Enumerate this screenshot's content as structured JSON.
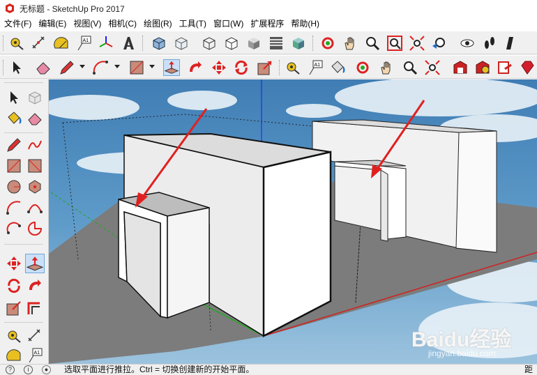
{
  "window": {
    "title": "无标题 - SketchUp Pro 2017"
  },
  "menu": [
    "文件(F)",
    "编辑(E)",
    "视图(V)",
    "相机(C)",
    "绘图(R)",
    "工具(T)",
    "窗口(W)",
    "扩展程序",
    "帮助(H)"
  ],
  "status": {
    "hint": "选取平面进行推拉。Ctrl = 切换创建新的开始平面。",
    "right_label": "距"
  },
  "watermark": {
    "brand": "Baidu经验",
    "url": "jingyan.baidu.com"
  },
  "tools": {
    "active": "push-pull",
    "text_label_icon": "A1"
  },
  "icons": [
    "tape-measure-icon",
    "dimension-icon",
    "protractor-icon",
    "text-icon",
    "axes-icon",
    "3d-text-icon",
    "iso-view-icon",
    "xray-icon",
    "wireframe-icon",
    "hidden-line-icon",
    "shaded-icon",
    "shaded-textures-icon",
    "monochrome-icon",
    "orbit-icon",
    "pan-icon",
    "zoom-icon",
    "zoom-window-icon",
    "zoom-extents-icon",
    "previous-view-icon",
    "position-camera-icon",
    "look-around-icon",
    "walk-icon",
    "select-icon",
    "eraser-icon",
    "pencil-icon",
    "arc-icon",
    "rectangle-icon",
    "push-pull-icon",
    "follow-me-icon",
    "move-icon",
    "rotate-icon",
    "scale-icon",
    "offset-icon",
    "paint-bucket-icon",
    "warehouse-icon",
    "extension-warehouse-icon",
    "send-to-layout-icon",
    "ruby-icon"
  ],
  "colors": {
    "accent_red": "#e02020",
    "axis_blue": "#1a1aff",
    "axis_green": "#1faa1f",
    "ground": "#7c7c7c"
  }
}
